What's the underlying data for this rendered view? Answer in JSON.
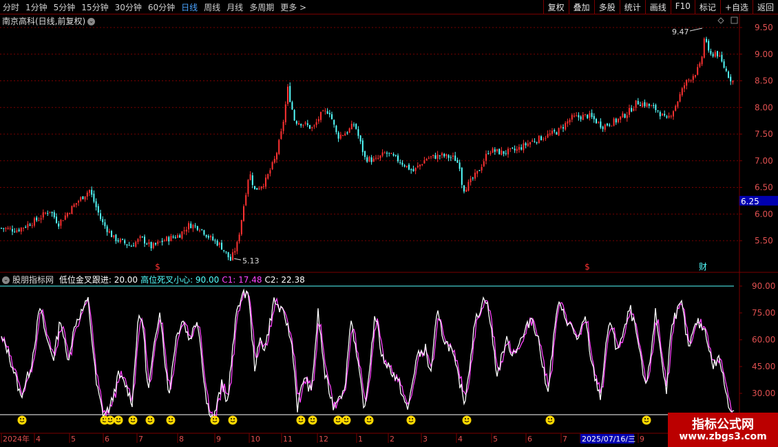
{
  "toolbar": {
    "periods": [
      "分时",
      "1分钟",
      "5分钟",
      "15分钟",
      "30分钟",
      "60分钟",
      "日线",
      "周线",
      "月线",
      "多周期",
      "更多 >"
    ],
    "active_period": "日线",
    "buttons": [
      "复权",
      "叠加",
      "多股",
      "统计",
      "画线",
      "F10",
      "标记",
      "+自选",
      "返回"
    ]
  },
  "stock": {
    "name": "南京高科(日线,前复权)"
  },
  "main_chart": {
    "price_axis": [
      "9.50",
      "9.00",
      "8.50",
      "8.00",
      "7.50",
      "7.00",
      "6.50",
      "6.00",
      "5.50"
    ],
    "current_price": "6.25",
    "high_label": "9.47",
    "low_label": "5.13",
    "event_markers": [
      "$",
      "$",
      "财"
    ],
    "colors": {
      "up": "#ff3232",
      "down": "#54ffff",
      "grid": "#7a0000",
      "current_price_bg": "#0000b0"
    }
  },
  "indicator": {
    "name": "股朋指标网",
    "params": [
      {
        "label": "低位金叉跟进: 20.00",
        "color": "#ffffff"
      },
      {
        "label": "高位死叉小心: 90.00",
        "color": "#54ffff"
      },
      {
        "label": "C1: 17.48",
        "color": "#ff44ff"
      },
      {
        "label": "C2: 22.38",
        "color": "#ffffff"
      }
    ],
    "axis": [
      "90.00",
      "75.00",
      "60.00",
      "45.00",
      "30.00"
    ],
    "colors": {
      "c1": "#ff44ff",
      "c2": "#ffffff",
      "level90": "#54ffff",
      "level20": "#ffffff",
      "signal": "#ffd700"
    }
  },
  "time_axis": {
    "labels": [
      "2024年",
      "4",
      "5",
      "6",
      "7",
      "8",
      "9",
      "10",
      "11",
      "12",
      "1",
      "2",
      "3",
      "4",
      "5",
      "6",
      "7",
      "2025/07/16/三",
      "9"
    ],
    "highlight": "2025/07/16/三"
  },
  "watermark": {
    "line1": "指标公式网",
    "line2": "www.zbgs3.com"
  }
}
